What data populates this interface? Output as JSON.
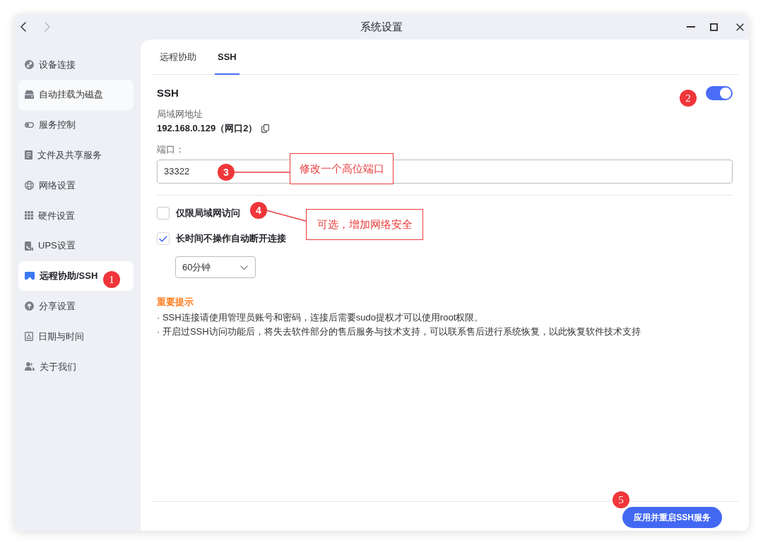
{
  "window": {
    "title": "系统设置",
    "navigation": [
      {
        "kind": "back",
        "disabled": false
      },
      {
        "kind": "forward",
        "disabled": true
      }
    ]
  },
  "sidebar": {
    "items": [
      {
        "label": "设备连接",
        "selected": false,
        "hovered": false
      },
      {
        "label": "自动挂载为磁盘",
        "selected": false,
        "hovered": true
      },
      {
        "label": "服务控制",
        "selected": false,
        "hovered": false
      },
      {
        "label": "文件及共享服务",
        "selected": false,
        "hovered": false
      },
      {
        "label": "网络设置",
        "selected": false,
        "hovered": false
      },
      {
        "label": "硬件设置",
        "selected": false,
        "hovered": false
      },
      {
        "label": "UPS设置",
        "selected": false,
        "hovered": false
      },
      {
        "label": "远程协助/SSH",
        "selected": true,
        "hovered": false
      },
      {
        "label": "分享设置",
        "selected": false,
        "hovered": false
      },
      {
        "label": "日期与时间",
        "selected": false,
        "hovered": false
      },
      {
        "label": "关于我们",
        "selected": false,
        "hovered": false
      }
    ]
  },
  "tabs": [
    {
      "label": "远程协助",
      "selected": false
    },
    {
      "label": "SSH",
      "selected": true
    }
  ],
  "ssh": {
    "title": "SSH",
    "on": true,
    "lan_address_label": "局域网地址",
    "lan_address": "192.168.0.129（网口2）",
    "port_label": "端口：",
    "port_value": "33322",
    "options": [
      {
        "label": "仅限局域网访问",
        "checked": false
      },
      {
        "label": "长时间不操作自动断开连接",
        "checked": true
      }
    ],
    "timeout": {
      "value": "60分钟"
    },
    "notice": {
      "title": "重要提示",
      "lines": [
        "· SSH连接请使用管理员账号和密码，连接后需要sudo提权才可以使用root权限。",
        "· 开启过SSH访问功能后，将失去软件部分的售后服务与技术支持，可以联系售后进行系统恢复，以此恢复软件技术支持"
      ]
    }
  },
  "footer": {
    "apply_button": "应用并重启SSH服务"
  },
  "annotations": [
    {
      "number": "1",
      "kind": "marker"
    },
    {
      "number": "2",
      "kind": "marker"
    },
    {
      "number": "3",
      "kind": "callout",
      "note": "修改一个高位端口"
    },
    {
      "number": "4",
      "kind": "callout",
      "note": "可选，增加网络安全"
    },
    {
      "number": "5",
      "kind": "marker"
    }
  ]
}
